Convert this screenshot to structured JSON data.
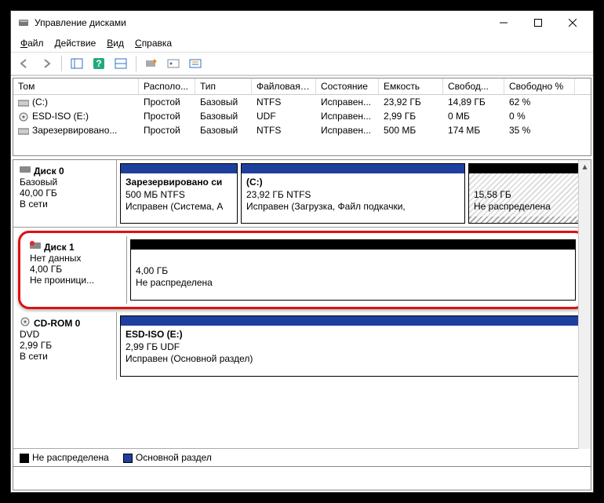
{
  "title": "Управление дисками",
  "menu": {
    "file": "Файл",
    "action": "Действие",
    "view": "Вид",
    "help": "Справка"
  },
  "columns": {
    "vol": "Том",
    "layout": "Располо...",
    "type": "Тип",
    "fs": "Файловая с...",
    "status": "Состояние",
    "cap": "Емкость",
    "free": "Свобод...",
    "freepct": "Свободно %"
  },
  "volumes": [
    {
      "name": "(C:)",
      "layout": "Простой",
      "type": "Базовый",
      "fs": "NTFS",
      "status": "Исправен...",
      "cap": "23,92 ГБ",
      "free": "14,89 ГБ",
      "pct": "62 %"
    },
    {
      "name": "ESD-ISO (E:)",
      "layout": "Простой",
      "type": "Базовый",
      "fs": "UDF",
      "status": "Исправен...",
      "cap": "2,99 ГБ",
      "free": "0 МБ",
      "pct": "0 %"
    },
    {
      "name": "Зарезервировано...",
      "layout": "Простой",
      "type": "Базовый",
      "fs": "NTFS",
      "status": "Исправен...",
      "cap": "500 МБ",
      "free": "174 МБ",
      "pct": "35 %"
    }
  ],
  "disk0": {
    "name": "Диск 0",
    "type": "Базовый",
    "size": "40,00 ГБ",
    "status": "В сети",
    "p1": {
      "title": "Зарезервировано си",
      "size": "500 МБ NTFS",
      "status": "Исправен (Система, А"
    },
    "p2": {
      "title": "(C:)",
      "size": "23,92 ГБ NTFS",
      "status": "Исправен (Загрузка, Файл подкачки,"
    },
    "p3": {
      "size": "15,58 ГБ",
      "status": "Не распределена"
    }
  },
  "disk1": {
    "name": "Диск 1",
    "type": "Нет данных",
    "size": "4,00 ГБ",
    "status": "Не проиници...",
    "p1": {
      "size": "4,00 ГБ",
      "status": "Не распределена"
    }
  },
  "cdrom": {
    "name": "CD-ROM 0",
    "type": "DVD",
    "size": "2,99 ГБ",
    "status": "В сети",
    "p1": {
      "title": "ESD-ISO  (E:)",
      "size": "2,99 ГБ UDF",
      "status": "Исправен (Основной раздел)"
    }
  },
  "legend": {
    "unalloc": "Не распределена",
    "primary": "Основной раздел"
  }
}
